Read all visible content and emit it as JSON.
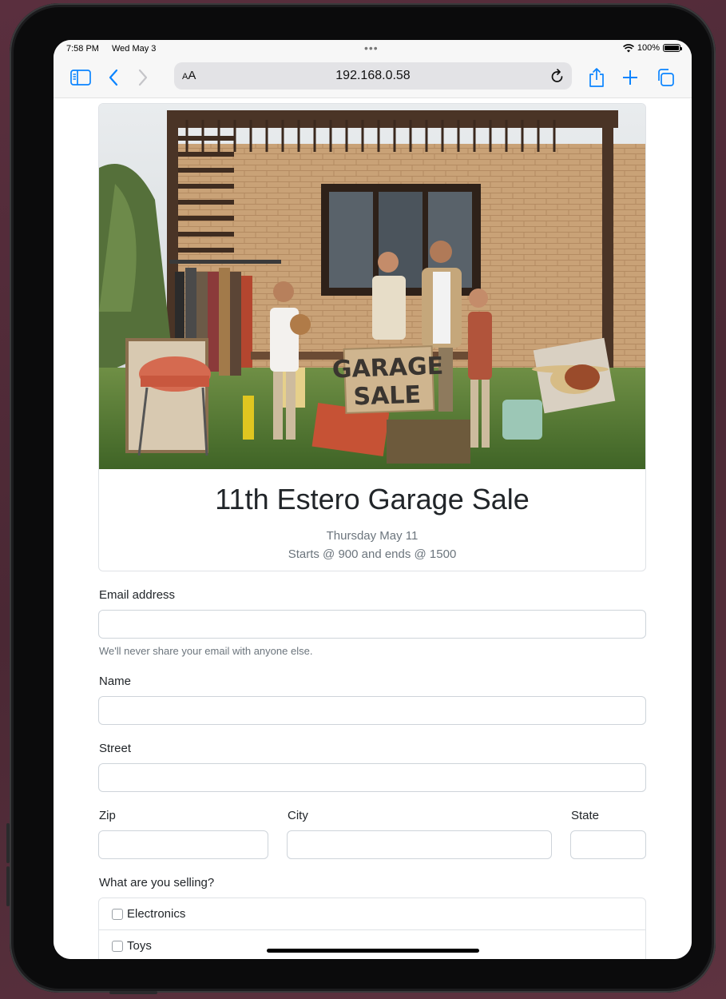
{
  "status": {
    "time": "7:58 PM",
    "date": "Wed May 3",
    "battery": "100%"
  },
  "browser": {
    "text_size_label_small": "A",
    "text_size_label_large": "A",
    "url": "192.168.0.58"
  },
  "event": {
    "title": "11th Estero Garage Sale",
    "date": "Thursday May 11",
    "times": "Starts @ 900 and ends @ 1500",
    "sign_line1": "GARAGE",
    "sign_line2": "SALE"
  },
  "form": {
    "email_label": "Email address",
    "email_help": "We'll never share your email with anyone else.",
    "name_label": "Name",
    "street_label": "Street",
    "zip_label": "Zip",
    "city_label": "City",
    "state_label": "State",
    "selling_label": "What are you selling?",
    "selling_options": [
      "Electronics",
      "Toys"
    ]
  },
  "colors": {
    "accent": "#0a84ff",
    "text": "#212529",
    "muted": "#6c757d",
    "border": "#ced4da"
  }
}
